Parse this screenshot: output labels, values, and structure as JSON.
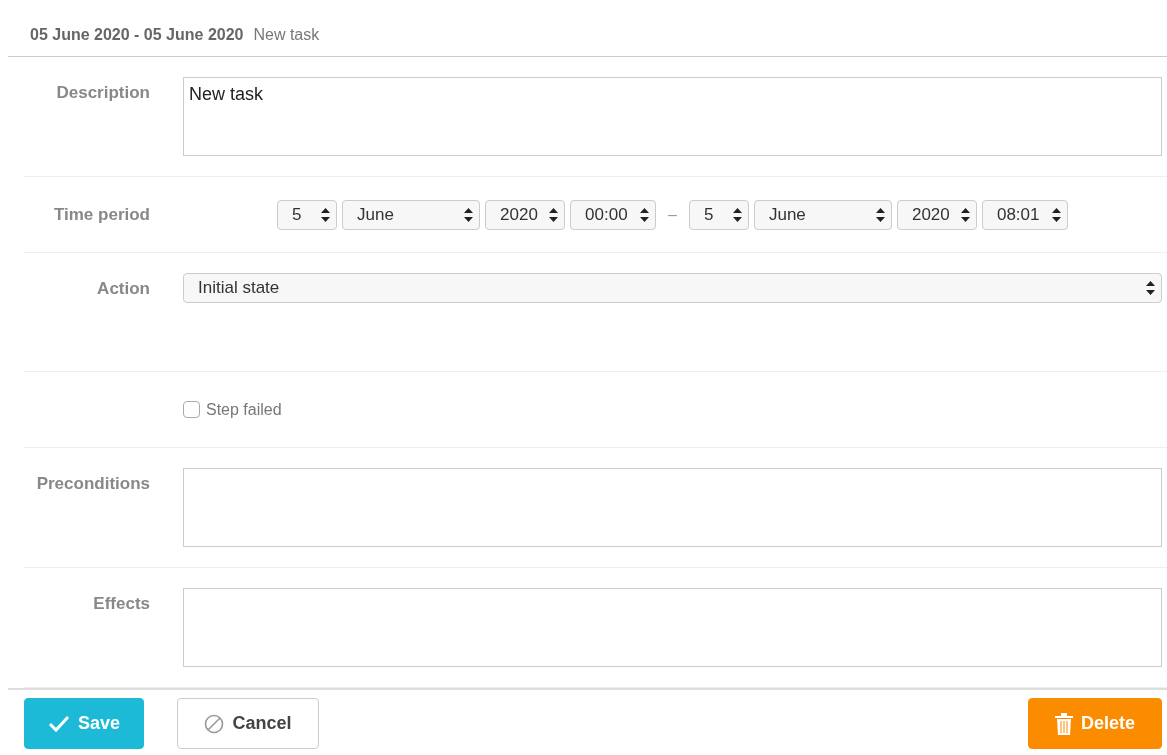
{
  "header": {
    "range": "05 June 2020 - 05 June 2020",
    "title": "New task"
  },
  "rows": [
    {
      "kind": "textarea",
      "label": "Description",
      "value": "New task"
    },
    {
      "kind": "period",
      "label": "Time period",
      "start": [
        "5",
        "June",
        "2020",
        "00:00"
      ],
      "separator": "–",
      "end": [
        "5",
        "June",
        "2020",
        "08:01"
      ]
    },
    {
      "kind": "select",
      "label": "Action",
      "value": "Initial state"
    },
    {
      "kind": "checkbox",
      "text": "Step failed",
      "checked": false
    },
    {
      "kind": "textarea",
      "label": "Preconditions",
      "value": ""
    },
    {
      "kind": "textarea",
      "label": "Effects",
      "value": ""
    }
  ],
  "buttons": [
    {
      "kind": "save",
      "label": "Save"
    },
    {
      "kind": "cancel",
      "label": "Cancel"
    },
    {
      "kind": "delete",
      "label": "Delete"
    }
  ]
}
